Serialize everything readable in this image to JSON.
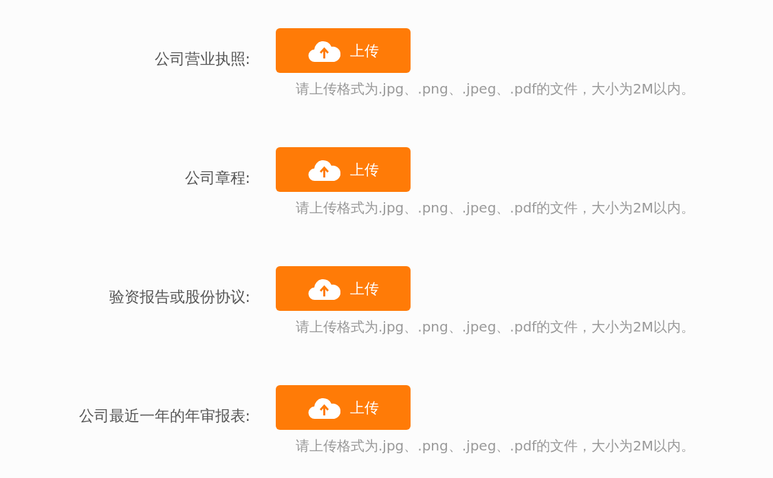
{
  "uploads": [
    {
      "label": "公司营业执照:",
      "button": "上传",
      "hint": "请上传格式为.jpg、.png、.jpeg、.pdf的文件，大小为2M以内。"
    },
    {
      "label": "公司章程:",
      "button": "上传",
      "hint": "请上传格式为.jpg、.png、.jpeg、.pdf的文件，大小为2M以内。"
    },
    {
      "label": "验资报告或股份协议:",
      "button": "上传",
      "hint": "请上传格式为.jpg、.png、.jpeg、.pdf的文件，大小为2M以内。"
    },
    {
      "label": "公司最近一年的年审报表:",
      "button": "上传",
      "hint": "请上传格式为.jpg、.png、.jpeg、.pdf的文件，大小为2M以内。"
    }
  ]
}
